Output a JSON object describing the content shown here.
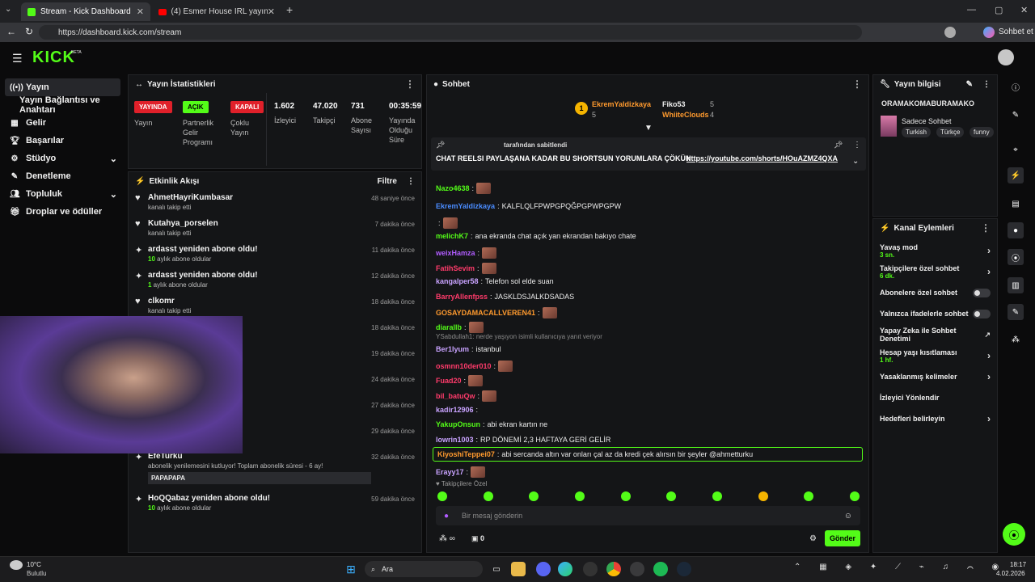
{
  "browser": {
    "tabs": [
      {
        "label": "Stream - Kick Dashboard"
      },
      {
        "label": "(4) Esmer House IRL yayın derleme"
      }
    ],
    "url": "https://dashboard.kick.com/stream",
    "profile_label": "Sohbet et"
  },
  "header": {
    "logo": "KICK",
    "beta": "BETA"
  },
  "sidebar": {
    "items": [
      {
        "label": "Yayın"
      },
      {
        "label": "Yayın Bağlantısı ve Anahtarı"
      },
      {
        "label": "Gelir"
      },
      {
        "label": "Başarılar"
      },
      {
        "label": "Stüdyo"
      },
      {
        "label": "Denetleme"
      },
      {
        "label": "Topluluk"
      },
      {
        "label": "Droplar ve ödüller"
      }
    ]
  },
  "stats": {
    "title": "Yayın İstatistikleri",
    "badges": [
      {
        "text": "YAYINDA",
        "caption": "Yayın",
        "color": "#e0202a"
      },
      {
        "text": "AÇIK",
        "caption": "Partnerlik Gelir Programı",
        "color": "#53fc18"
      },
      {
        "text": "KAPALI",
        "caption": "Çoklu Yayın",
        "color": "#e0202a"
      }
    ],
    "values": [
      {
        "value": "1.602",
        "caption": "İzleyici"
      },
      {
        "value": "47.020",
        "caption": "Takipçi"
      },
      {
        "value": "731",
        "caption": "Abone Sayısı"
      },
      {
        "value": "00:35:59",
        "caption": "Yayında Olduğu Süre"
      }
    ]
  },
  "activity": {
    "title": "Etkinlik Akışı",
    "filter": "Filtre",
    "items": [
      {
        "user": "AhmetHayriKumbasar",
        "desc": "kanalı takip etti",
        "time": "48 saniye önce",
        "icon": "♥"
      },
      {
        "user": "Kutahya_porselen",
        "desc": "kanalı takip etti",
        "time": "7 dakika önce",
        "icon": "♥"
      },
      {
        "user": "ardasst yeniden abone oldu!",
        "desc_num": "10",
        "desc": " aylık abone oldular",
        "time": "11 dakika önce",
        "icon": "✦"
      },
      {
        "user": "ardasst yeniden abone oldu!",
        "desc_num": "1",
        "desc": " aylık abone oldular",
        "time": "12 dakika önce",
        "icon": "✦"
      },
      {
        "user": "clkomr",
        "desc": "kanalı takip etti",
        "time": "18 dakika önce",
        "icon": "♥"
      },
      {
        "user": "",
        "desc": "",
        "time": "18 dakika önce",
        "icon": ""
      },
      {
        "user": "",
        "desc": "",
        "time": "19 dakika önce",
        "icon": ""
      },
      {
        "user": "",
        "desc": "",
        "time": "24 dakika önce",
        "icon": ""
      },
      {
        "user": "",
        "desc": "oplam abonelik süresi - 2 ay!",
        "time": "27 dakika önce",
        "icon": ""
      },
      {
        "user": "Mryilnzgin",
        "desc": "kanalı takip etti",
        "time": "29 dakika önce",
        "icon": "♥"
      },
      {
        "user": "EfeTurku",
        "desc": "abonelik yenilemesini kutluyor! Toplam abonelik süresi - 6 ay!",
        "time": "32 dakika önce",
        "icon": "✦",
        "msg": "PAPAPAPA"
      },
      {
        "user": "HoQQabaz yeniden abone oldu!",
        "desc_num": "10",
        "desc": " aylık abone oldular",
        "time": "59 dakika önce",
        "icon": "✦"
      }
    ]
  },
  "chat": {
    "title": "Sohbet",
    "top": [
      {
        "rank": "1",
        "user": "EkremYaldizkaya",
        "count": "5"
      },
      {
        "user": "Fiko53",
        "count": "5"
      },
      {
        "user": "WhiiteClouds",
        "count": "4"
      }
    ],
    "pinned": {
      "by": "tarafından sabitlendi",
      "text": "CHAT REELSI PAYLAŞANA KADAR BU SHORTSUN YORUMLARA ÇÖKÜN",
      "link": "https://youtube.com/shorts/HOuAZMZ4QXA"
    },
    "messages": [
      {
        "user": "Nazo4638",
        "color": "#53fc18",
        "text": "",
        "emote": true
      },
      {
        "user": "EkremYaldizkaya",
        "color": "#4a8cff",
        "text": "KALFLQLFPWPGPQĞPGPWPGPW"
      },
      {
        "user": "",
        "color": "#ff3b6b",
        "text": "",
        "emote": true
      },
      {
        "user": "melichK7",
        "color": "#53fc18",
        "text": "ana ekranda chat açık yan ekrandan bakıyo chate"
      },
      {
        "user": "weixHamza",
        "color": "#b15cff",
        "text": "",
        "emote": true
      },
      {
        "user": "FatihSevim",
        "color": "#ff3b6b",
        "text": "",
        "emote": true
      },
      {
        "user": "kangalper58",
        "color": "#c9a3ff",
        "text": "Telefon sol elde suan"
      },
      {
        "user": "BarryAllenfpss",
        "color": "#ff3b6b",
        "text": "JASKLDSJALKDSADAS"
      },
      {
        "user": "GOSAYDAMACALLVEREN41",
        "color": "#ff9a2e",
        "text": "",
        "emote": true
      },
      {
        "user": "diarallb",
        "color": "#53fc18",
        "text": "",
        "emote": true
      },
      {
        "user": "Ber1lyum",
        "color": "#c9a3ff",
        "text": "istanbul",
        "reply": "YSabdullah1: nerde yaşıyon isimli kullanıcıya yanıt veriyor"
      },
      {
        "user": "osmnn10der010",
        "color": "#ff3b6b",
        "text": "",
        "emote": true
      },
      {
        "user": "Fuad20",
        "color": "#ff3b6b",
        "text": "",
        "emote": true
      },
      {
        "user": "bil_batuQw",
        "color": "#ff3b6b",
        "text": "",
        "emote": true
      },
      {
        "user": "kadir12906",
        "color": "#c9a3ff",
        "text": ""
      },
      {
        "user": "YakupOnsun",
        "color": "#53fc18",
        "text": "abi ekran kartın ne"
      },
      {
        "user": "lowrin1003",
        "color": "#c9a3ff",
        "text": "RP DÖNEMİ 2,3 HAFTAYA GERİ GELİR"
      },
      {
        "user": "KiyoshiTeppei07",
        "color": "#ff9a2e",
        "text": "abi sercanda altın var onları çal az da kredi çek alırsın bir şeyler @ahmetturku"
      },
      {
        "user": "Erayy17",
        "color": "#c9a3ff",
        "text": "",
        "emote": true
      }
    ],
    "followers_only": "Takipçilere Özel",
    "input_placeholder": "Bir mesaj gönderin",
    "send": "Gönder",
    "viewer_count": "0"
  },
  "info": {
    "title": "Yayın bilgisi",
    "stream_title": "ORAMAKOMABURAMAKO",
    "category": "Sadece Sohbet",
    "tags": [
      "Turkish",
      "Türkçe",
      "funny"
    ]
  },
  "actions": {
    "title": "Kanal Eylemleri",
    "items": [
      {
        "label": "Yavaş mod",
        "sub": "3 sn.",
        "type": "chevron"
      },
      {
        "label": "Takipçilere özel sohbet",
        "sub": "6 dk.",
        "type": "chevron"
      },
      {
        "label": "Abonelere özel sohbet",
        "sub": "",
        "type": "toggle"
      },
      {
        "label": "Yalnızca ifadelerle sohbet",
        "sub": "",
        "type": "toggle"
      },
      {
        "label": "Yapay Zeka ile Sohbet Denetimi",
        "sub": "",
        "type": "link"
      },
      {
        "label": "Hesap yaşı kısıtlaması",
        "sub": "1 hf.",
        "type": "chevron"
      },
      {
        "label": "Yasaklanmış kelimeler",
        "sub": "",
        "type": "chevron"
      },
      {
        "label": "İzleyici Yönlendir",
        "sub": "",
        "type": "none"
      },
      {
        "label": "Hedefleri belirleyin",
        "sub": "",
        "type": "chevron"
      }
    ]
  },
  "taskbar": {
    "weather_temp": "10°C",
    "weather_desc": "Bulutlu",
    "search": "Ara",
    "time": "18:17",
    "date": "4.02.2026"
  },
  "colors": {
    "accent": "#53fc18",
    "live": "#e0202a"
  }
}
